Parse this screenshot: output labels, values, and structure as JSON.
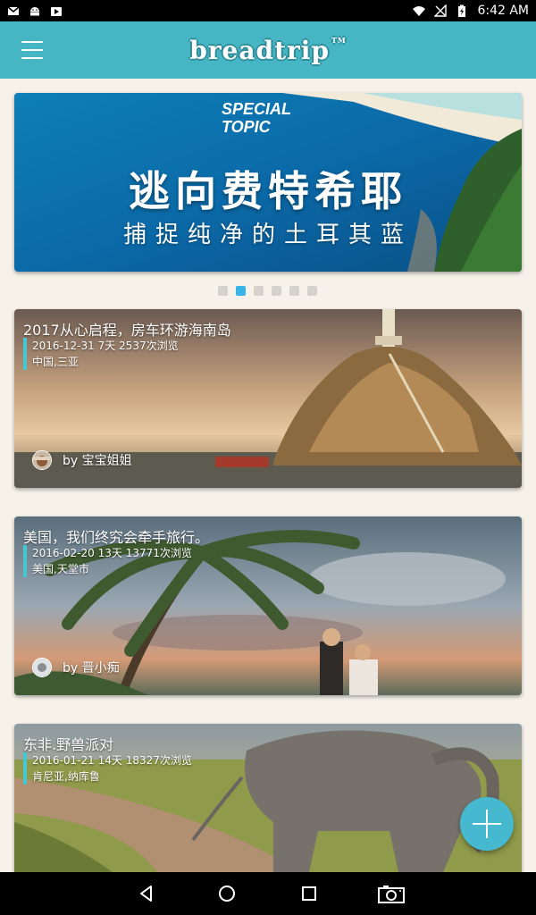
{
  "status_bar": {
    "time": "6:42 AM",
    "left_icons": [
      "gmail-icon",
      "android-icon",
      "play-store-icon"
    ],
    "right_icons": [
      "wifi-icon",
      "no-signal-icon",
      "battery-icon"
    ]
  },
  "app_bar": {
    "logo_text": "breadtrip",
    "trademark": "TM",
    "menu_icon": "hamburger-menu-icon"
  },
  "banner": {
    "tag_line1": "SPECIAL",
    "tag_line2": "TOPIC",
    "title": "逃向费特希耶",
    "subtitle": "捕捉纯净的土耳其蓝",
    "dots_count": 6,
    "active_dot": 1
  },
  "trips": [
    {
      "title": "2017从心启程，房车环游海南岛",
      "date": "2016-12-31",
      "days": "7天",
      "views": "2537次浏览",
      "location": "中国,三亚",
      "by": "by",
      "author": "宝宝姐姐"
    },
    {
      "title": "美国，我们终究会牵手旅行。",
      "date": "2016-02-20",
      "days": "13天",
      "views": "13771次浏览",
      "location": "美国,天堂市",
      "by": "by",
      "author": "晋小痴"
    },
    {
      "title": "东非.野兽派对",
      "date": "2016-01-21",
      "days": "14天",
      "views": "18327次浏览",
      "location": "肯尼亚,纳库鲁",
      "by": "by",
      "author": ""
    }
  ],
  "fab": {
    "icon": "plus-icon"
  },
  "nav_bar": {
    "buttons": [
      "back-icon",
      "home-icon",
      "recents-icon",
      "camera-icon"
    ]
  },
  "colors": {
    "accent": "#46b6c4",
    "active_dot": "#39b4e6",
    "fab": "#46b9d0"
  }
}
